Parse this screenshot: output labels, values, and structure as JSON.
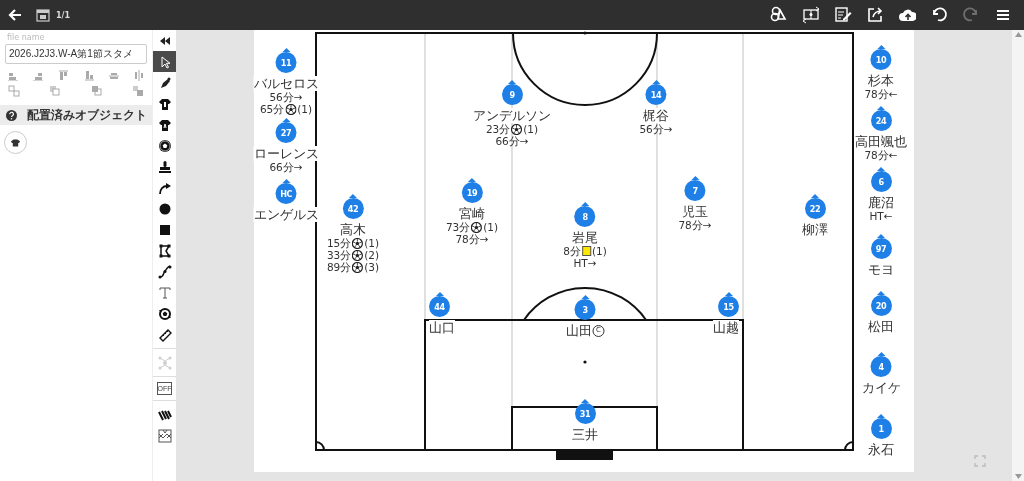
{
  "topbar": {
    "page_indicator": "1/1",
    "actions": [
      {
        "kind": "shapes",
        "disabled": false
      },
      {
        "kind": "swap_field",
        "disabled": false
      },
      {
        "kind": "notes",
        "disabled": false
      },
      {
        "kind": "share",
        "disabled": false
      },
      {
        "kind": "upload",
        "disabled": false
      },
      {
        "kind": "undo",
        "disabled": false
      },
      {
        "kind": "redo",
        "disabled": true
      },
      {
        "kind": "menu",
        "disabled": false
      }
    ]
  },
  "file": {
    "label": "file name",
    "value": "2026.J2J3.W-A第1節スタメ"
  },
  "objects_panel": {
    "title": "配置済みオブジェクト"
  },
  "tools": [
    {
      "kind": "collapse",
      "selected": false,
      "disabled": false
    },
    {
      "kind": "select",
      "selected": true,
      "disabled": false
    },
    {
      "kind": "pen",
      "selected": false,
      "disabled": false
    },
    {
      "kind": "shirt_home",
      "selected": false,
      "disabled": false
    },
    {
      "kind": "shirt_away",
      "selected": false,
      "disabled": false
    },
    {
      "kind": "ball",
      "selected": false,
      "disabled": false
    },
    {
      "kind": "stamp",
      "selected": false,
      "disabled": false
    },
    {
      "kind": "arrow",
      "selected": false,
      "disabled": false
    },
    {
      "kind": "circle",
      "selected": false,
      "disabled": false
    },
    {
      "kind": "square",
      "selected": false,
      "disabled": false
    },
    {
      "kind": "polygon",
      "selected": false,
      "disabled": false
    },
    {
      "kind": "curve",
      "selected": false,
      "disabled": false
    },
    {
      "kind": "text",
      "selected": false,
      "disabled": false
    },
    {
      "kind": "ball_rotate",
      "selected": false,
      "disabled": false
    },
    {
      "kind": "ruler",
      "selected": false,
      "disabled": false
    },
    {
      "kind": "formation",
      "selected": false,
      "disabled": true
    },
    {
      "kind": "offside",
      "label": "OFF",
      "selected": false,
      "disabled": false
    },
    {
      "kind": "hatch",
      "selected": false,
      "disabled": false
    },
    {
      "kind": "pattern",
      "selected": false,
      "disabled": false
    }
  ],
  "board": {
    "left_bench": [
      {
        "number": "11",
        "name": "バルセロス",
        "events": [
          {
            "kind": "text",
            "text": "56分→"
          },
          {
            "kind": "goal",
            "minute": "65分",
            "count": "(1)"
          }
        ]
      },
      {
        "number": "27",
        "name": "ローレンス",
        "events": [
          {
            "kind": "text",
            "text": "66分→"
          }
        ]
      },
      {
        "number": "HC",
        "name": "エンゲルス"
      }
    ],
    "players": [
      {
        "number": "9",
        "name": "アンデルソン",
        "events": [
          {
            "kind": "goal",
            "minute": "23分",
            "count": "(1)"
          },
          {
            "kind": "text",
            "text": "66分→"
          }
        ]
      },
      {
        "number": "14",
        "name": "梶谷",
        "events": [
          {
            "kind": "text",
            "text": "56分→"
          }
        ]
      },
      {
        "number": "42",
        "name": "高木",
        "events": [
          {
            "kind": "goal",
            "minute": "15分",
            "count": "(1)"
          },
          {
            "kind": "goal",
            "minute": "33分",
            "count": "(2)"
          },
          {
            "kind": "goal",
            "minute": "89分",
            "count": "(3)"
          }
        ]
      },
      {
        "number": "19",
        "name": "宮崎",
        "events": [
          {
            "kind": "goal",
            "minute": "73分",
            "count": "(1)"
          },
          {
            "kind": "text",
            "text": "78分→"
          }
        ]
      },
      {
        "number": "8",
        "name": "岩尾",
        "events": [
          {
            "kind": "yellow_card",
            "minute": "8分",
            "count": "(1)"
          },
          {
            "kind": "text",
            "text": "HT→"
          }
        ]
      },
      {
        "number": "7",
        "name": "児玉",
        "events": [
          {
            "kind": "text",
            "text": "78分→"
          }
        ]
      },
      {
        "number": "22",
        "name": "柳澤"
      },
      {
        "number": "44",
        "name": "山口"
      },
      {
        "number": "3",
        "name": "山田",
        "captain_mark": "C"
      },
      {
        "number": "15",
        "name": "山越"
      },
      {
        "number": "31",
        "name": "三井"
      }
    ],
    "right_bench": [
      {
        "number": "10",
        "name": "杉本",
        "events": [
          {
            "kind": "text",
            "text": "78分←"
          }
        ]
      },
      {
        "number": "24",
        "name": "高田颯也",
        "events": [
          {
            "kind": "text",
            "text": "78分←"
          }
        ]
      },
      {
        "number": "6",
        "name": "鹿沼",
        "events": [
          {
            "kind": "text",
            "text": "HT←"
          }
        ]
      },
      {
        "number": "97",
        "name": "モヨ"
      },
      {
        "number": "20",
        "name": "松田"
      },
      {
        "number": "4",
        "name": "カイケ"
      },
      {
        "number": "1",
        "name": "永石"
      }
    ]
  }
}
